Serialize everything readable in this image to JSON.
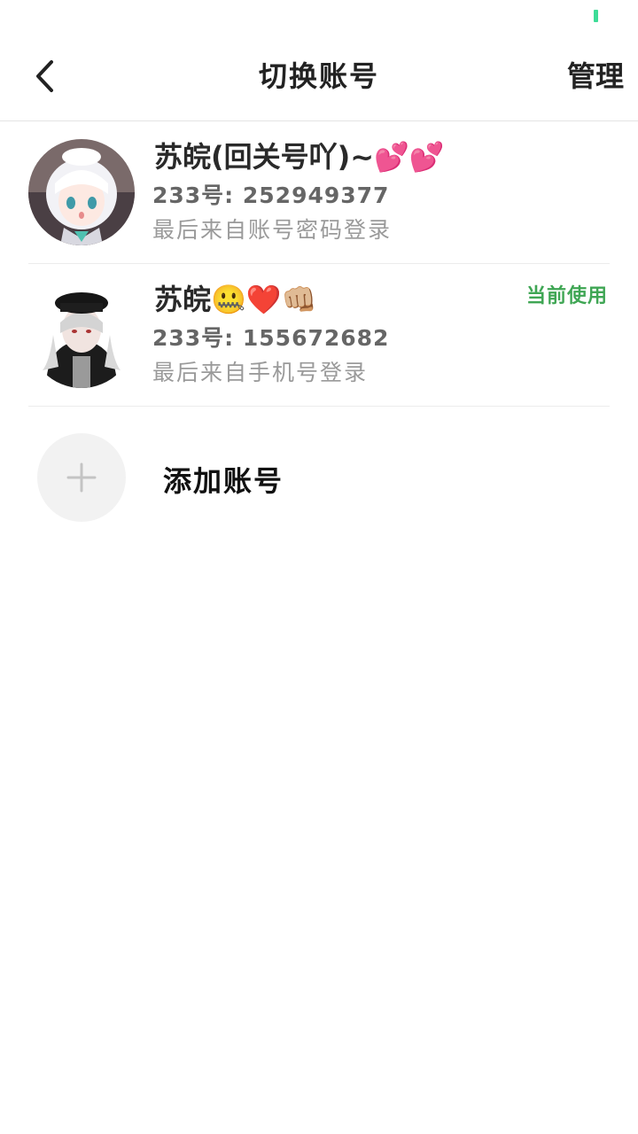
{
  "status_bar": {
    "indicator_color": "#3ddc97"
  },
  "header": {
    "back_icon": "chevron-left-icon",
    "title": "切换账号",
    "manage_label": "管理"
  },
  "accounts": [
    {
      "name": "苏皖(回关号吖)~💕💕",
      "id_text": "233号: 252949377",
      "last_login": "最后来自账号密码登录",
      "current": false,
      "avatar_icon": "anime-avatar-white-hair-icon"
    },
    {
      "name": "苏皖🤐❤️👊🏼",
      "id_text": "233号: 155672682",
      "last_login": "最后来自手机号登录",
      "current": true,
      "current_label": "当前使用",
      "avatar_icon": "anime-avatar-black-coat-icon"
    }
  ],
  "add_account": {
    "icon": "plus-icon",
    "label": "添加账号"
  },
  "colors": {
    "accent_green": "#3fa654",
    "divider": "#ececec",
    "add_circle_bg": "#f2f2f2"
  }
}
